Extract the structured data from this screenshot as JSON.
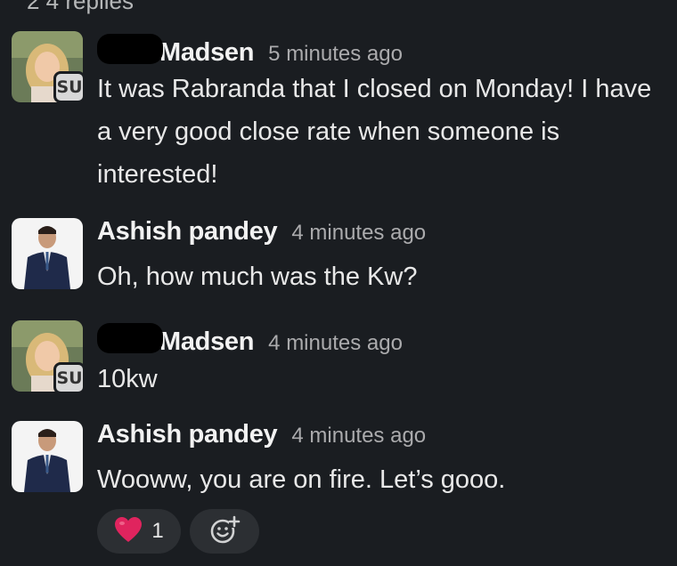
{
  "thread": {
    "replies_label": "2 4 replies"
  },
  "messages": [
    {
      "author": "Madsen",
      "timestamp": "5 minutes ago",
      "badge": "SU",
      "text": "It was Rabranda that I closed on Monday! I have a very good close rate when someone is interested!"
    },
    {
      "author": "Ashish pandey",
      "timestamp": "4 minutes ago",
      "text": "Oh, how much was the Kw?"
    },
    {
      "author": "Madsen",
      "timestamp": "4 minutes ago",
      "badge": "SU",
      "text": "10kw"
    },
    {
      "author": "Ashish pandey",
      "timestamp": "4 minutes ago",
      "text": "Wooww, you are on fire. Let’s gooo."
    }
  ],
  "reactions": [
    {
      "icon": "heart-icon",
      "count": "1"
    },
    {
      "icon": "add-emoji-icon"
    }
  ],
  "colors": {
    "background": "#1a1d21",
    "reaction_bg": "#2c2f33",
    "heart": "#e0245e"
  }
}
